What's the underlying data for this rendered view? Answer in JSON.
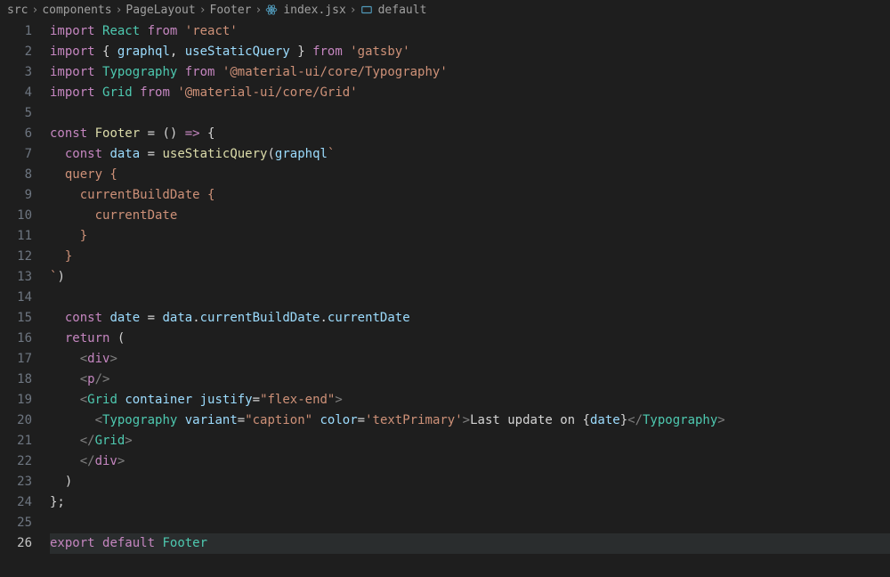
{
  "breadcrumb": {
    "items": [
      "src",
      "components",
      "PageLayout",
      "Footer",
      "index.jsx",
      "default"
    ]
  },
  "code": {
    "lines": [
      {
        "n": 1,
        "tokens": [
          {
            "cls": "kw",
            "t": "import"
          },
          {
            "cls": "punc",
            "t": " "
          },
          {
            "cls": "comp",
            "t": "React"
          },
          {
            "cls": "punc",
            "t": " "
          },
          {
            "cls": "kw",
            "t": "from"
          },
          {
            "cls": "punc",
            "t": " "
          },
          {
            "cls": "str",
            "t": "'react'"
          }
        ]
      },
      {
        "n": 2,
        "tokens": [
          {
            "cls": "kw",
            "t": "import"
          },
          {
            "cls": "punc",
            "t": " { "
          },
          {
            "cls": "var",
            "t": "graphql"
          },
          {
            "cls": "punc",
            "t": ", "
          },
          {
            "cls": "var",
            "t": "useStaticQuery"
          },
          {
            "cls": "punc",
            "t": " } "
          },
          {
            "cls": "kw",
            "t": "from"
          },
          {
            "cls": "punc",
            "t": " "
          },
          {
            "cls": "str",
            "t": "'gatsby'"
          }
        ]
      },
      {
        "n": 3,
        "tokens": [
          {
            "cls": "kw",
            "t": "import"
          },
          {
            "cls": "punc",
            "t": " "
          },
          {
            "cls": "comp",
            "t": "Typography"
          },
          {
            "cls": "punc",
            "t": " "
          },
          {
            "cls": "kw",
            "t": "from"
          },
          {
            "cls": "punc",
            "t": " "
          },
          {
            "cls": "str",
            "t": "'@material-ui/core/Typography'"
          }
        ]
      },
      {
        "n": 4,
        "tokens": [
          {
            "cls": "kw",
            "t": "import"
          },
          {
            "cls": "punc",
            "t": " "
          },
          {
            "cls": "comp",
            "t": "Grid"
          },
          {
            "cls": "punc",
            "t": " "
          },
          {
            "cls": "kw",
            "t": "from"
          },
          {
            "cls": "punc",
            "t": " "
          },
          {
            "cls": "str",
            "t": "'@material-ui/core/Grid'"
          }
        ]
      },
      {
        "n": 5,
        "tokens": []
      },
      {
        "n": 6,
        "tokens": [
          {
            "cls": "kw",
            "t": "const"
          },
          {
            "cls": "punc",
            "t": " "
          },
          {
            "cls": "fn",
            "t": "Footer"
          },
          {
            "cls": "punc",
            "t": " = () "
          },
          {
            "cls": "kw",
            "t": "=>"
          },
          {
            "cls": "punc",
            "t": " {"
          }
        ]
      },
      {
        "n": 7,
        "indent": 1,
        "tokens": [
          {
            "cls": "kw",
            "t": "const"
          },
          {
            "cls": "punc",
            "t": " "
          },
          {
            "cls": "var",
            "t": "data"
          },
          {
            "cls": "punc",
            "t": " = "
          },
          {
            "cls": "fn",
            "t": "useStaticQuery"
          },
          {
            "cls": "punc",
            "t": "("
          },
          {
            "cls": "var",
            "t": "graphql"
          },
          {
            "cls": "str",
            "t": "`"
          }
        ]
      },
      {
        "n": 8,
        "indent": 1,
        "tokens": [
          {
            "cls": "str",
            "t": "query {"
          }
        ]
      },
      {
        "n": 9,
        "indent": 2,
        "tokens": [
          {
            "cls": "str",
            "t": "currentBuildDate {"
          }
        ]
      },
      {
        "n": 10,
        "indent": 3,
        "tokens": [
          {
            "cls": "str",
            "t": "currentDate"
          }
        ]
      },
      {
        "n": 11,
        "indent": 2,
        "tokens": [
          {
            "cls": "str",
            "t": "}"
          }
        ]
      },
      {
        "n": 12,
        "indent": 1,
        "tokens": [
          {
            "cls": "str",
            "t": "}"
          }
        ]
      },
      {
        "n": 13,
        "tokens": [
          {
            "cls": "str",
            "t": "`"
          },
          {
            "cls": "punc",
            "t": ")"
          }
        ]
      },
      {
        "n": 14,
        "tokens": []
      },
      {
        "n": 15,
        "indent": 1,
        "tokens": [
          {
            "cls": "kw",
            "t": "const"
          },
          {
            "cls": "punc",
            "t": " "
          },
          {
            "cls": "var",
            "t": "date"
          },
          {
            "cls": "punc",
            "t": " = "
          },
          {
            "cls": "var",
            "t": "data"
          },
          {
            "cls": "punc",
            "t": "."
          },
          {
            "cls": "prop",
            "t": "currentBuildDate"
          },
          {
            "cls": "punc",
            "t": "."
          },
          {
            "cls": "prop",
            "t": "currentDate"
          }
        ]
      },
      {
        "n": 16,
        "indent": 1,
        "tokens": [
          {
            "cls": "kw",
            "t": "return"
          },
          {
            "cls": "punc",
            "t": " ("
          }
        ]
      },
      {
        "n": 17,
        "indent": 2,
        "tokens": [
          {
            "cls": "tag-angle",
            "t": "<"
          },
          {
            "cls": "kw",
            "t": "div"
          },
          {
            "cls": "tag-angle",
            "t": ">"
          }
        ]
      },
      {
        "n": 18,
        "indent": 2,
        "tokens": [
          {
            "cls": "tag-angle",
            "t": "<"
          },
          {
            "cls": "kw",
            "t": "p"
          },
          {
            "cls": "tag-angle",
            "t": "/>"
          }
        ]
      },
      {
        "n": 19,
        "indent": 2,
        "tokens": [
          {
            "cls": "tag-angle",
            "t": "<"
          },
          {
            "cls": "tag",
            "t": "Grid"
          },
          {
            "cls": "punc",
            "t": " "
          },
          {
            "cls": "attr",
            "t": "container"
          },
          {
            "cls": "punc",
            "t": " "
          },
          {
            "cls": "attr",
            "t": "justify"
          },
          {
            "cls": "punc",
            "t": "="
          },
          {
            "cls": "str",
            "t": "\"flex-end\""
          },
          {
            "cls": "tag-angle",
            "t": ">"
          }
        ]
      },
      {
        "n": 20,
        "indent": 3,
        "tokens": [
          {
            "cls": "tag-angle",
            "t": "<"
          },
          {
            "cls": "tag",
            "t": "Typography"
          },
          {
            "cls": "punc",
            "t": " "
          },
          {
            "cls": "attr",
            "t": "variant"
          },
          {
            "cls": "punc",
            "t": "="
          },
          {
            "cls": "str",
            "t": "\"caption\""
          },
          {
            "cls": "punc",
            "t": " "
          },
          {
            "cls": "attr",
            "t": "color"
          },
          {
            "cls": "punc",
            "t": "="
          },
          {
            "cls": "str",
            "t": "'textPrimary'"
          },
          {
            "cls": "tag-angle",
            "t": ">"
          },
          {
            "cls": "text",
            "t": "Last update on "
          },
          {
            "cls": "punc",
            "t": "{"
          },
          {
            "cls": "var",
            "t": "date"
          },
          {
            "cls": "punc",
            "t": "}"
          },
          {
            "cls": "tag-angle",
            "t": "</"
          },
          {
            "cls": "tag",
            "t": "Typography"
          },
          {
            "cls": "tag-angle",
            "t": ">"
          }
        ]
      },
      {
        "n": 21,
        "indent": 2,
        "tokens": [
          {
            "cls": "tag-angle",
            "t": "</"
          },
          {
            "cls": "tag",
            "t": "Grid"
          },
          {
            "cls": "tag-angle",
            "t": ">"
          }
        ]
      },
      {
        "n": 22,
        "indent": 2,
        "tokens": [
          {
            "cls": "tag-angle",
            "t": "</"
          },
          {
            "cls": "kw",
            "t": "div"
          },
          {
            "cls": "tag-angle",
            "t": ">"
          }
        ]
      },
      {
        "n": 23,
        "indent": 1,
        "tokens": [
          {
            "cls": "punc",
            "t": ")"
          }
        ]
      },
      {
        "n": 24,
        "tokens": [
          {
            "cls": "punc",
            "t": "};"
          }
        ]
      },
      {
        "n": 25,
        "tokens": []
      },
      {
        "n": 26,
        "active": true,
        "tokens": [
          {
            "cls": "kw",
            "t": "export"
          },
          {
            "cls": "punc",
            "t": " "
          },
          {
            "cls": "kw",
            "t": "default"
          },
          {
            "cls": "punc",
            "t": " "
          },
          {
            "cls": "comp",
            "t": "Footer"
          }
        ]
      }
    ]
  }
}
